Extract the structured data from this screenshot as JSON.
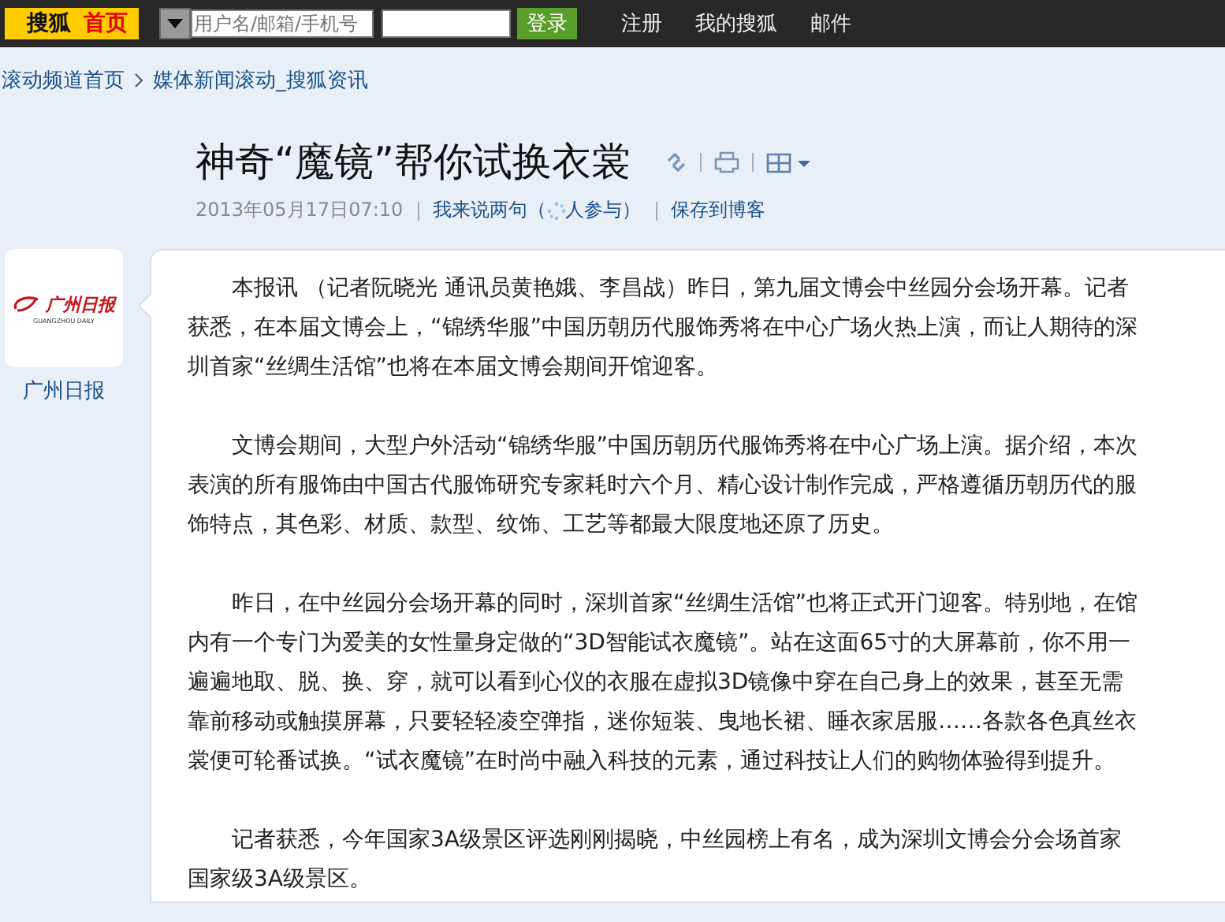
{
  "top_bar": {
    "logo": {
      "brand": "搜狐",
      "home": "首页"
    },
    "login": {
      "username_placeholder": "用户名/邮箱/手机号",
      "button": "登录"
    },
    "links": [
      "注册",
      "我的搜狐",
      "邮件"
    ]
  },
  "breadcrumb": [
    "滚动频道首页",
    "媒体新闻滚动_搜狐资讯"
  ],
  "article": {
    "title": "神奇“魔镜”帮你试换衣裳",
    "date": "2013年05月17日07:10",
    "comment_link": {
      "before": "我来说两句（",
      "after": "人参与）"
    },
    "save_link": "保存到博客",
    "source": {
      "logo_name": "广州日报",
      "logo_english": "GUANGZHOU DAILY",
      "name": "广州日报"
    },
    "paragraphs": [
      "本报讯 （记者阮晓光 通讯员黄艳娥、李昌战）昨日，第九届文博会中丝园分会场开幕。记者获悉，在本届文博会上，“锦绣华服”中国历朝历代服饰秀将在中心广场火热上演，而让人期待的深圳首家“丝绸生活馆”也将在本届文博会期间开馆迎客。",
      "文博会期间，大型户外活动“锦绣华服”中国历朝历代服饰秀将在中心广场上演。据介绍，本次表演的所有服饰由中国古代服饰研究专家耗时六个月、精心设计制作完成，严格遵循历朝历代的服饰特点，其色彩、材质、款型、纹饰、工艺等都最大限度地还原了历史。",
      "昨日，在中丝园分会场开幕的同时，深圳首家“丝绸生活馆”也将正式开门迎客。特别地，在馆内有一个专门为爱美的女性量身定做的“3D智能试衣魔镜”。站在这面65寸的大屏幕前，你不用一遍遍地取、脱、换、穿，就可以看到心仪的衣服在虚拟3D镜像中穿在自己身上的效果，甚至无需靠前移动或触摸屏幕，只要轻轻凌空弹指，迷你短装、曳地长裙、睡衣家居服……各款各色真丝衣裳便可轮番试换。“试衣魔镜”在时尚中融入科技的元素，通过科技让人们的购物体验得到提升。",
      "记者获悉，今年国家3A级景区评选刚刚揭晓，中丝园榜上有名，成为深圳文博会分会场首家国家级3A级景区。"
    ]
  }
}
